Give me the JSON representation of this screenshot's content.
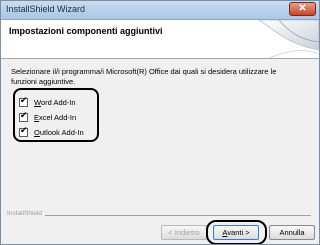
{
  "window": {
    "title": "InstallShield Wizard",
    "close_glyph": "✕"
  },
  "header": {
    "title": "Impostazioni componenti aggiuntivi"
  },
  "description": "Selezionare il/i programma/i Microsoft(R) Office dai quali si desidera utilizzare le funzioni aggiuntive.",
  "addins": [
    {
      "label": "Word Add-In",
      "checked": true,
      "mnemonic": "W",
      "rest": "ord Add-In"
    },
    {
      "label": "Excel Add-In",
      "checked": true,
      "mnemonic": "E",
      "rest": "xcel Add-In"
    },
    {
      "label": "Outlook Add-In",
      "checked": true,
      "mnemonic": "O",
      "rest": "utlook Add-In"
    }
  ],
  "footer": {
    "brand": "InstallShield"
  },
  "buttons": {
    "back_label": "< Indietro",
    "next_prefix": "",
    "next_mnemonic": "A",
    "next_rest": "vanti >",
    "next_label": "Avanti >",
    "cancel_label": "Annulla"
  },
  "colors": {
    "accent": "#3d7bbf",
    "titlebar": "#a9c6e4",
    "close": "#c4452a"
  },
  "icons": {
    "check": "✔"
  }
}
